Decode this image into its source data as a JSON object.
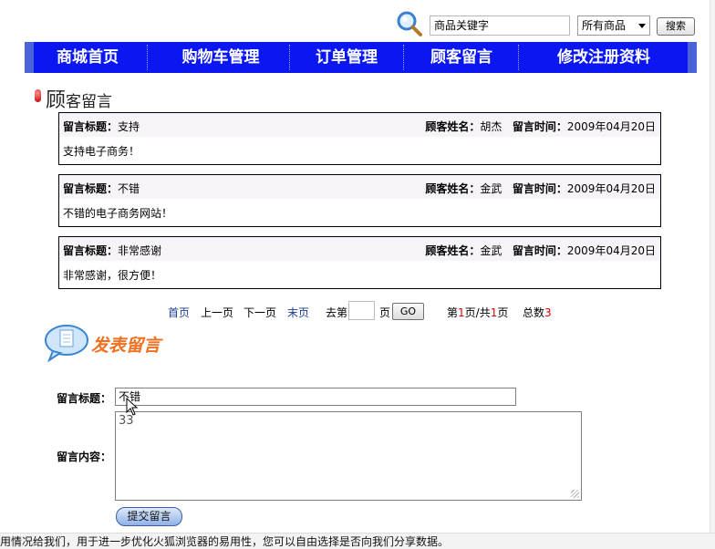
{
  "search": {
    "placeholder": "商品关键字",
    "category": "所有商品",
    "button": "搜索"
  },
  "nav": {
    "items": [
      "商城首页",
      "购物车管理",
      "订单管理",
      "顾客留言",
      "修改注册资料"
    ]
  },
  "page": {
    "heading_first": "顾",
    "heading_rest": "客留言"
  },
  "messages": [
    {
      "title_label": "留言标题：",
      "title": "支持",
      "name_label": "顾客姓名：",
      "name": "胡杰",
      "time_label": "留言时间：",
      "time": "2009年04月20日",
      "content": "支持电子商务！"
    },
    {
      "title_label": "留言标题：",
      "title": "不错",
      "name_label": "顾客姓名：",
      "name": "金武",
      "time_label": "留言时间：",
      "time": "2009年04月20日",
      "content": "不错的电子商务网站！"
    },
    {
      "title_label": "留言标题：",
      "title": "非常感谢",
      "name_label": "顾客姓名：",
      "name": "金武",
      "time_label": "留言时间：",
      "time": "2009年04月20日",
      "content": "非常感谢，很方便！"
    }
  ],
  "pager": {
    "first": "首页",
    "prev": "上一页",
    "next": "下一页",
    "last": "末页",
    "goto_prefix": "去第",
    "goto_suffix": "页",
    "go": "GO",
    "page_prefix": "第",
    "current": "1",
    "page_mid": "页/共",
    "total_pages": "1",
    "page_suffix": "页",
    "count_label": "总数",
    "count": "3"
  },
  "post": {
    "title": "发表留言",
    "title_label": "留言标题：",
    "title_value": "不错",
    "content_label": "留言内容：",
    "content_value": "33",
    "submit": "提交留言"
  },
  "notice": {
    "text": "用情况给我们，用于进一步优化火狐浏览器的易用性，您可以自由选择是否向我们分享数据。"
  },
  "colors": {
    "nav_bg": "#0a17f2",
    "post_title": "#f07020",
    "pager_highlight": "#e00000"
  }
}
